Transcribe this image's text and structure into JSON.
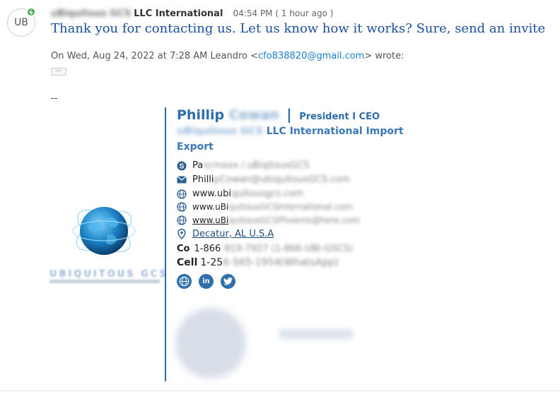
{
  "avatar": {
    "initials": "UB"
  },
  "header": {
    "sender_blurred": "uBiquitous GCS",
    "sender": "LLC International",
    "timestamp": "04:54 PM ( 1 hour ago )"
  },
  "message": {
    "body": "Thank you for contacting us.  Let us know how it works? Sure, send an invite"
  },
  "quote": {
    "prefix": "On Wed, Aug 24, 2022 at 7:28 AM Leandro <",
    "email": "cfo838820@gmail.com",
    "suffix": "> wrote:",
    "ellipsis": "···"
  },
  "signature": {
    "dashes": "--",
    "logo_text": "UBIQUITOUS GCS",
    "first_name": "Phillip",
    "last_name_blurred": "Cowan",
    "pipe": "|",
    "title": "President I CEO",
    "company_blurred": "uBiquitous GCS",
    "company": "LLC International Import Export",
    "contacts": [
      {
        "icon": "skype-icon",
        "prefix": "Pa",
        "blurred": "scmxxx / uBiqitousGCS"
      },
      {
        "icon": "email-icon",
        "prefix": "Philli",
        "blurred": "pCowan@ubiquitousGCS.com"
      },
      {
        "icon": "web-icon",
        "prefix": "www.ubi",
        "blurred": "quitousgcs.com"
      },
      {
        "icon": "web-icon",
        "prefix": "www.uBi",
        "blurred": "quitousGCSInternational.com"
      },
      {
        "icon": "web-icon",
        "prefix": "www.uBi",
        "blurred": "quitousGCSPhoenix@here.com"
      },
      {
        "icon": "location-icon",
        "text": "Decatur, AL U.S.A"
      },
      {
        "label": "Co",
        "prefix": "1-866",
        "blurred": "-919-7927 (1-866-UBI-GSCS)"
      },
      {
        "label": "Cell",
        "prefix": "1-25",
        "blurred": "6-565-1954(WhatsApp)"
      }
    ],
    "social": [
      "globe-icon",
      "linkedin-icon",
      "twitter-icon"
    ],
    "social_labels": [
      "",
      "in",
      ""
    ]
  },
  "colors": {
    "accent": "#2e6cac",
    "link": "#1a7fd0",
    "message_text": "#1b4fa0",
    "status": "#4caf50"
  }
}
